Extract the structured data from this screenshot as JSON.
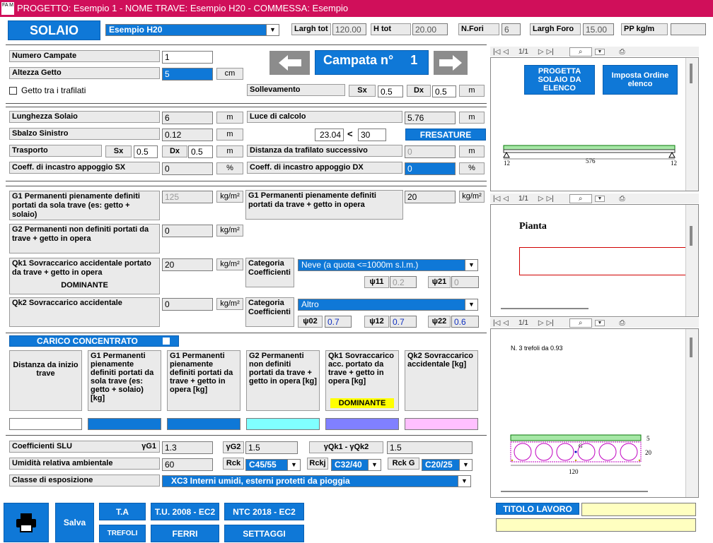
{
  "window": {
    "title": "PROGETTO: Esempio 1 - NOME TRAVE: Esempio H20 - COMMESSA: Esempio",
    "app_icon": "FA M"
  },
  "header": {
    "solaio": "SOLAIO",
    "trave_select": "Esempio H20",
    "largh_tot_label": "Largh tot",
    "largh_tot": "120.00",
    "h_tot_label": "H tot",
    "h_tot": "20.00",
    "n_fori_label": "N.Fori",
    "n_fori": "6",
    "largh_foro_label": "Largh Foro",
    "largh_foro": "15.00",
    "pp_label": "PP kg/m",
    "pp": ""
  },
  "campate": {
    "numero_label": "Numero Campate",
    "numero": "1",
    "altezza_label": "Altezza Getto",
    "altezza": "5",
    "altezza_unit": "cm",
    "getto_label": "Getto tra i trafilati",
    "campata_title": "Campata n°",
    "campata_n": "1",
    "sollevamento_label": "Sollevamento",
    "sx_label": "Sx",
    "sx": "0.5",
    "dx_label": "Dx",
    "dx": "0.5",
    "m": "m"
  },
  "geometry": {
    "lunghezza_label": "Lunghezza Solaio",
    "lunghezza": "6",
    "lunghezza_unit": "m",
    "luce_label": "Luce di calcolo",
    "luce": "5.76",
    "luce_unit": "m",
    "sbalzo_label": "Sbalzo Sinistro",
    "sbalzo": "0.12",
    "sbalzo_unit": "m",
    "ratio": "23.04",
    "lt": "<",
    "ratio_limit": "30",
    "fresature": "FRESATURE",
    "trasporto_label": "Trasporto",
    "tr_sx_label": "Sx",
    "tr_sx": "0.5",
    "tr_dx_label": "Dx",
    "tr_dx": "0.5",
    "tr_unit": "m",
    "distanza_label": "Distanza da trafilato successivo",
    "distanza": "0",
    "distanza_unit": "m",
    "coeff_sx_label": "Coeff. di incastro appoggio SX",
    "coeff_sx": "0",
    "coeff_sx_unit": "%",
    "coeff_dx_label": "Coeff. di incastro appoggio DX",
    "coeff_dx": "0",
    "coeff_dx_unit": "%"
  },
  "loads": {
    "g1a_label": "G1 Permanenti pienamente definiti portati da sola trave (es: getto + solaio)",
    "g1a": "125",
    "g1a_unit": "kg/m²",
    "g1b_label": "G1 Permanenti pienamente definiti portati da trave + getto in opera",
    "g1b": "20",
    "g1b_unit": "kg/m²",
    "g2_label": "G2 Permanenti non definiti portati da trave + getto in opera",
    "g2": "0",
    "g2_unit": "kg/m²",
    "qk1_label": "Qk1 Sovraccarico accidentale portato da trave + getto in opera",
    "qk1_dom": "DOMINANTE",
    "qk1": "20",
    "qk1_unit": "kg/m²",
    "cat_label": "Categoria Coefficienti",
    "cat1": "Neve (a quota <=1000m s.l.m.)",
    "psi11_label": "ψ11",
    "psi11": "0.2",
    "psi21_label": "ψ21",
    "psi21": "0",
    "qk2_label": "Qk2  Sovraccarico accidentale",
    "qk2": "0",
    "qk2_unit": "kg/m²",
    "cat2": "Altro",
    "psi02_label": "ψ02",
    "psi02": "0.7",
    "psi12_label": "ψ12",
    "psi12": "0.7",
    "psi22_label": "ψ22",
    "psi22": "0.6"
  },
  "concentrato": {
    "title": "CARICO CONCENTRATO",
    "cols": [
      "Distanza da inizio trave",
      "G1 Permanenti pienamente definiti portati da sola trave (es: getto + solaio) [kg]",
      "G1 Permanenti pienamente definiti portati da trave + getto in opera   [kg]",
      "G2 Permanenti non definiti portati da trave + getto in opera [kg]",
      "Qk1 Sovraccarico acc. portato da trave + getto in opera [kg]",
      "Qk2 Sovraccarico accidentale [kg]"
    ],
    "dominante": "DOMINANTE"
  },
  "slu": {
    "coeff_label": "Coefficienti SLU",
    "g1_label": "γG1",
    "g1": "1.3",
    "g2_label": "γG2",
    "g2": "1.5",
    "qk_label": "γQk1 - γQk2",
    "qk": "1.5",
    "umid_label": "Umidità relativa ambientale",
    "umid": "60",
    "rck_label": "Rck",
    "rck": "C45/55",
    "rckj_label": "Rckj",
    "rckj": "C32/40",
    "rckg_label": "Rck G",
    "rckg": "C20/25",
    "classe_label": "Classe di esposizione",
    "classe": "XC3   Interni umidi, esterni protetti da pioggia"
  },
  "footer": {
    "salva": "Salva",
    "ta": "T.A",
    "tu": "T.U. 2008 - EC2",
    "ntc": "NTC 2018 - EC2",
    "trefoli": "TREFOLI",
    "ferri": "FERRI",
    "settaggi": "SETTAGGI",
    "titolo": "TITOLO LAVORO",
    "titolo_value": ""
  },
  "preview": {
    "page": "1/1",
    "btn_progetta": "PROGETTA SOLAIO DA ELENCO",
    "btn_ordine": "Imposta Ordine elenco",
    "beam_left": "12",
    "beam_mid": "576",
    "beam_right": "12",
    "pianta": "Pianta",
    "trefoli": "N. 3 trefoli da 0.93",
    "sec_h1": "5",
    "sec_h2": "20",
    "sec_w": "120",
    "sec_g": "G"
  }
}
